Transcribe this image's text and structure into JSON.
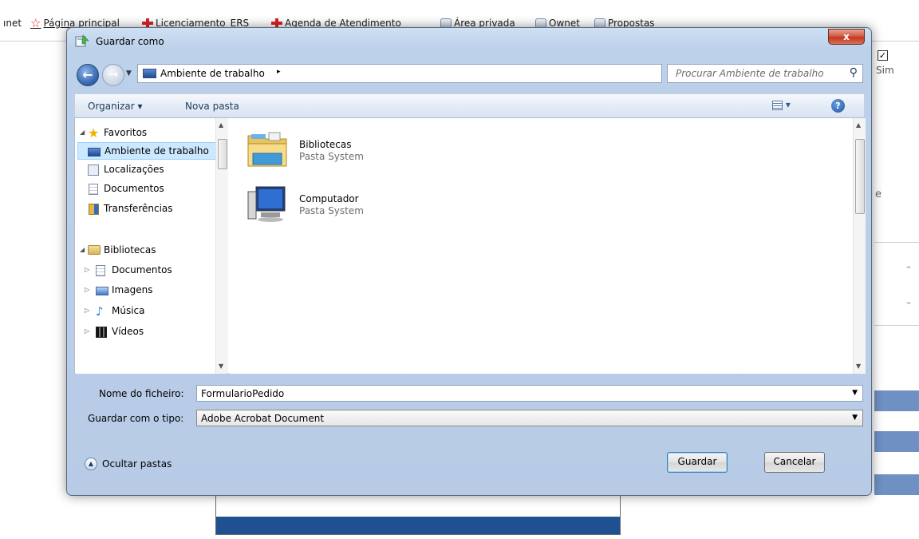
{
  "browser": {
    "bookmarks": [
      {
        "label": "ınet",
        "icon": "none"
      },
      {
        "label": "Página principal",
        "icon": "star-icon"
      },
      {
        "label": "Licenciamento_ERS",
        "icon": "flag-icon"
      },
      {
        "label": "Agenda de Atendimento",
        "icon": "flag-icon"
      },
      {
        "label": "Área privada",
        "icon": "page-icon"
      },
      {
        "label": "Ownet",
        "icon": "page-icon"
      },
      {
        "label": "Propostas",
        "icon": "page-icon"
      }
    ],
    "bg_checkbox_mark": "✓",
    "bg_sim": "Sim",
    "bg_e": "e"
  },
  "dialog": {
    "title": "Guardar como",
    "close_label": "x",
    "address": {
      "location": "Ambiente de trabalho",
      "separator": "▸"
    },
    "search": {
      "placeholder": "Procurar Ambiente de trabalho"
    },
    "toolbar": {
      "organize_label": "Organizar ▾",
      "new_folder_label": "Nova pasta"
    },
    "nav": {
      "favorites": {
        "label": "Favoritos",
        "items": [
          "Ambiente de trabalho",
          "Localizações",
          "Documentos",
          "Transferências"
        ]
      },
      "libraries": {
        "label": "Bibliotecas",
        "items": [
          "Documentos",
          "Imagens",
          "Música",
          "Vídeos"
        ]
      }
    },
    "files": [
      {
        "name": "Bibliotecas",
        "type": "Pasta System"
      },
      {
        "name": "Computador",
        "type": "Pasta System"
      }
    ],
    "form": {
      "filename_label": "Nome do ficheiro:",
      "filename_value": "FormularioPedido",
      "filetype_label": "Guardar com o tipo:",
      "filetype_value": "Adobe Acrobat Document"
    },
    "hide_folders_label": "Ocultar pastas",
    "save_label": "Guardar",
    "cancel_label": "Cancelar"
  },
  "colors": {
    "accent": "#1f5192",
    "close_button": "#c2391c",
    "selection": "#cce8ff"
  }
}
